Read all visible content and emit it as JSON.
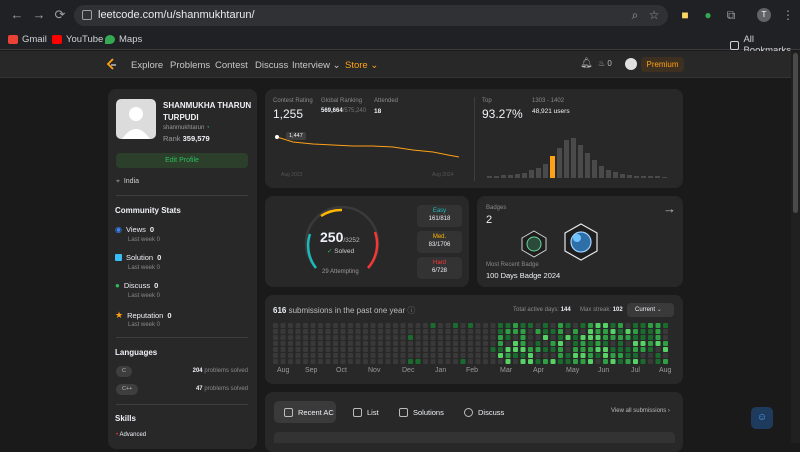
{
  "browser": {
    "url": "leetcode.com/u/shanmukhtarun/",
    "profile_initial": "T",
    "bookmarks": [
      {
        "label": "Gmail",
        "color": "#ea4335"
      },
      {
        "label": "YouTube",
        "color": "#ff0000"
      },
      {
        "label": "Maps",
        "color": "#34a853"
      }
    ],
    "all_bookmarks": "All Bookmarks"
  },
  "nav": {
    "links": [
      "Explore",
      "Problems",
      "Contest",
      "Discuss",
      "Interview",
      "Store"
    ],
    "streak_count": "0",
    "premium": "Premium"
  },
  "profile": {
    "name_line1": "SHANMUKHA THARUN",
    "name_line2": "TURPUDI",
    "username": "shanmukhtarun",
    "rank_label": "Rank",
    "rank_value": "359,579",
    "edit_button": "Edit Profile",
    "location": "India"
  },
  "community": {
    "title": "Community Stats",
    "items": [
      {
        "label": "Views",
        "value": "0",
        "sub": "Last week 0",
        "color": "#3b82f6"
      },
      {
        "label": "Solution",
        "value": "0",
        "sub": "Last week 0",
        "color": "#38bdf8"
      },
      {
        "label": "Discuss",
        "value": "0",
        "sub": "Last week 0",
        "color": "#2cbb5d"
      },
      {
        "label": "Reputation",
        "value": "0",
        "sub": "Last week 0",
        "color": "#ffa116"
      }
    ]
  },
  "languages": {
    "title": "Languages",
    "items": [
      {
        "name": "C",
        "count": "204",
        "suffix": "problems solved"
      },
      {
        "name": "C++",
        "count": "47",
        "suffix": "problems solved"
      }
    ]
  },
  "skills": {
    "title": "Skills",
    "first": "Advanced"
  },
  "contest": {
    "rating_label": "Contest Rating",
    "rating_value": "1,255",
    "global_label": "Global Ranking",
    "global_value": "569,664",
    "global_total": "/575,240",
    "attended_label": "Attended",
    "attended_value": "18",
    "tooltip": "1,447",
    "year_start": "Aug 2023",
    "year_end": "Aug 2024",
    "top_label": "Top",
    "top_value": "93.27%",
    "users_range": "1303 - 1402",
    "users_value": "48,921 users"
  },
  "solved": {
    "count": "250",
    "total": "/3252",
    "label": "Solved",
    "attempting": "29 Attempting",
    "progress_fraction": 0.077,
    "easy_label": "Easy",
    "easy_value": "161/818",
    "easy_color": "#1cbaba",
    "medium_label": "Med.",
    "medium_value": "83/1706",
    "medium_color": "#ffb700",
    "hard_label": "Hard",
    "hard_value": "6/728",
    "hard_color": "#f63737"
  },
  "badges": {
    "label": "Badges",
    "count": "2",
    "recent_label": "Most Recent Badge",
    "recent_name": "100 Days Badge 2024"
  },
  "submissions": {
    "count": "616",
    "text": "submissions in the past one year",
    "active_label": "Total active days:",
    "active_value": "144",
    "streak_label": "Max streak:",
    "streak_value": "102",
    "dropdown": "Current",
    "months": [
      "Aug",
      "Sep",
      "Oct",
      "Nov",
      "Dec",
      "Jan",
      "Feb",
      "Mar",
      "Apr",
      "May",
      "Jun",
      "Jul",
      "Aug"
    ]
  },
  "tabs": {
    "items": [
      "Recent AC",
      "List",
      "Solutions",
      "Discuss"
    ],
    "view_all": "View all submissions"
  },
  "colors": {
    "accent": "#ffa116",
    "green": "#2cbb5d"
  }
}
